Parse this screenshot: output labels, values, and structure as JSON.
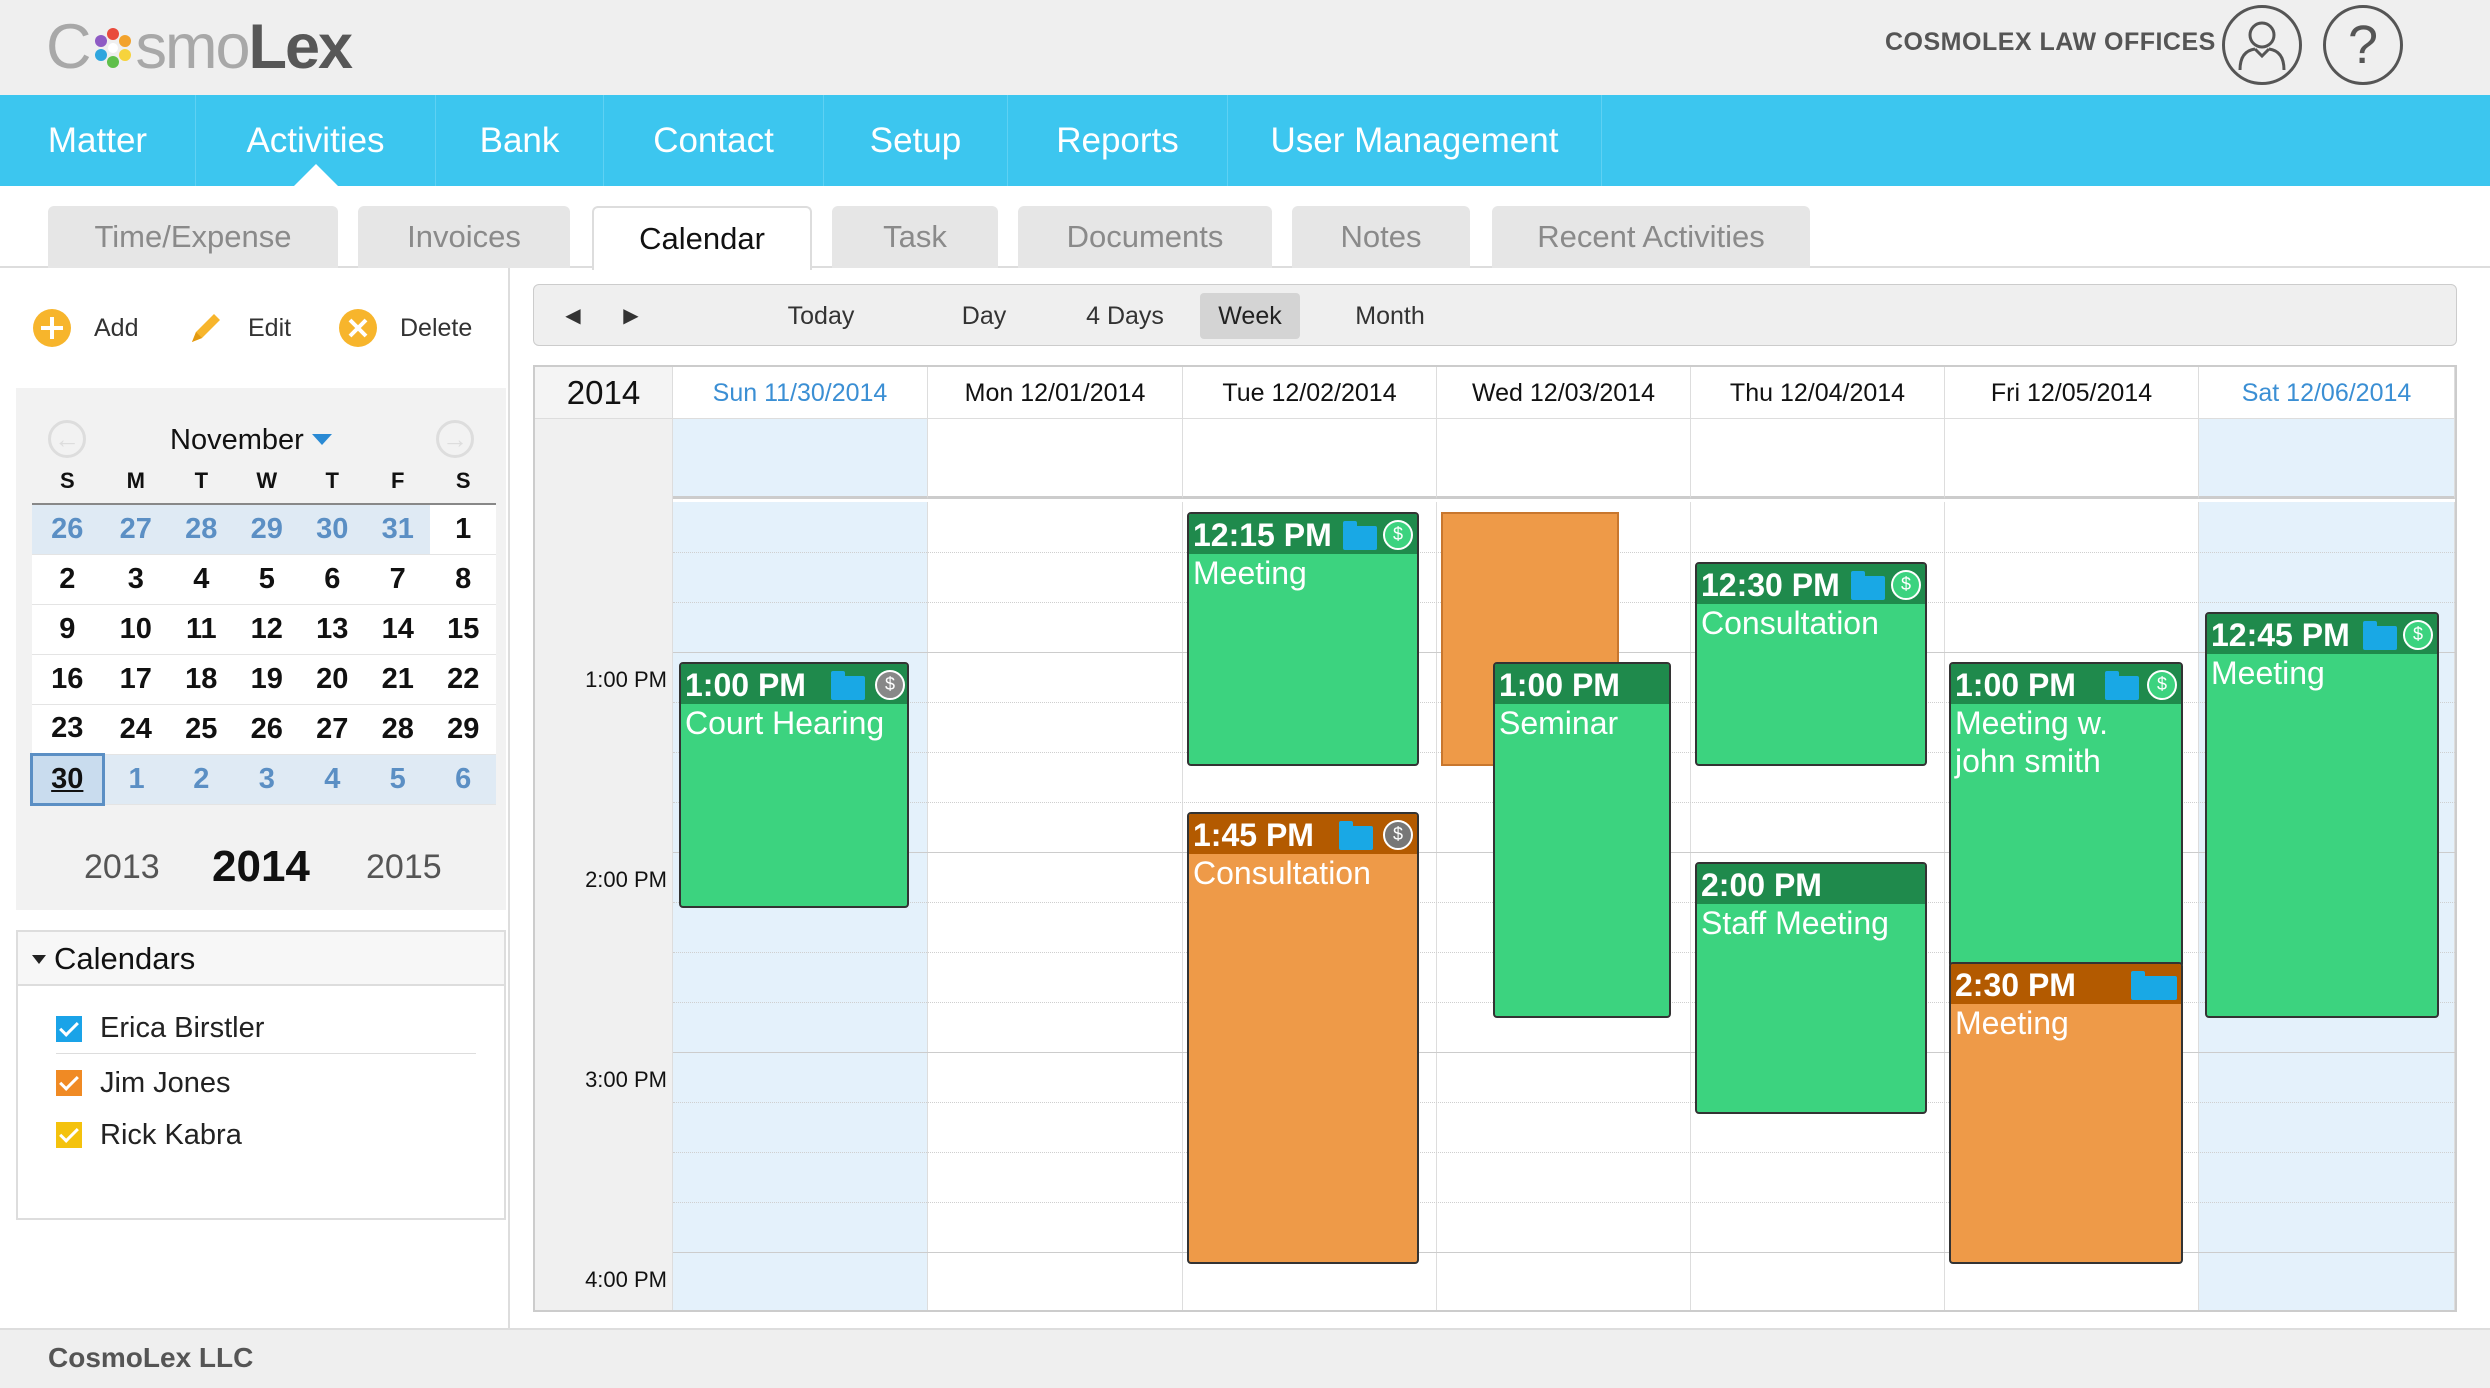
{
  "brand": {
    "logo_light": "C",
    "logo_light_rest": "smo",
    "logo_bold": "Lex",
    "firm_name": "COSMOLEX LAW OFFICES",
    "help_glyph": "?"
  },
  "nav": {
    "items": [
      "Matter",
      "Activities",
      "Bank",
      "Contact",
      "Setup",
      "Reports",
      "User Management"
    ],
    "active": "Activities"
  },
  "subnav": {
    "tabs": [
      "Time/Expense",
      "Invoices",
      "Calendar",
      "Task",
      "Documents",
      "Notes",
      "Recent Activities"
    ],
    "active": "Calendar"
  },
  "toolbar": {
    "add": "Add",
    "edit": "Edit",
    "delete": "Delete"
  },
  "mini_calendar": {
    "month": "November",
    "weekdays": [
      "S",
      "M",
      "T",
      "W",
      "T",
      "F",
      "S"
    ],
    "weeks": [
      [
        "26",
        "27",
        "28",
        "29",
        "30",
        "31",
        "1"
      ],
      [
        "2",
        "3",
        "4",
        "5",
        "6",
        "7",
        "8"
      ],
      [
        "9",
        "10",
        "11",
        "12",
        "13",
        "14",
        "15"
      ],
      [
        "16",
        "17",
        "18",
        "19",
        "20",
        "21",
        "22"
      ],
      [
        "23",
        "24",
        "25",
        "26",
        "27",
        "28",
        "29"
      ],
      [
        "30",
        "1",
        "2",
        "3",
        "4",
        "5",
        "6"
      ]
    ],
    "years": [
      "2013",
      "2014",
      "2015"
    ]
  },
  "calendars": {
    "title": "Calendars",
    "items": [
      {
        "name": "Erica Birstler",
        "color": "#1aa3e8"
      },
      {
        "name": "Jim Jones",
        "color": "#f08a24"
      },
      {
        "name": "Rick Kabra",
        "color": "#f4c20d"
      }
    ]
  },
  "views": {
    "today": "Today",
    "day": "Day",
    "four_days": "4 Days",
    "week": "Week",
    "month": "Month",
    "active": "Week"
  },
  "week": {
    "year": "2014",
    "days": [
      "Sun 11/30/2014",
      "Mon 12/01/2014",
      "Tue 12/02/2014",
      "Wed 12/03/2014",
      "Thu 12/04/2014",
      "Fri 12/05/2014",
      "Sat 12/06/2014"
    ],
    "times": [
      "1:00 PM",
      "2:00 PM",
      "3:00 PM",
      "4:00 PM"
    ]
  },
  "events": {
    "sun_court": {
      "time": "1:00 PM",
      "title": "Court Hearing"
    },
    "tue_meeting": {
      "time": "12:15 PM",
      "title": "Meeting"
    },
    "tue_consult": {
      "time": "1:45 PM",
      "title": "Consultation"
    },
    "wed_seminar": {
      "time": "1:00 PM",
      "title": "Seminar"
    },
    "thu_consult": {
      "time": "12:30 PM",
      "title": "Consultation"
    },
    "thu_staff": {
      "time": "2:00 PM",
      "title": "Staff Meeting"
    },
    "fri_meeting": {
      "time": "1:00 PM",
      "title": "Meeting w. john smith"
    },
    "fri_meeting2": {
      "time": "2:30 PM",
      "title": "Meeting"
    },
    "sat_meeting": {
      "time": "12:45 PM",
      "title": "Meeting"
    }
  },
  "billing_glyph": "$",
  "footer": {
    "company": "CosmoLex LLC"
  }
}
